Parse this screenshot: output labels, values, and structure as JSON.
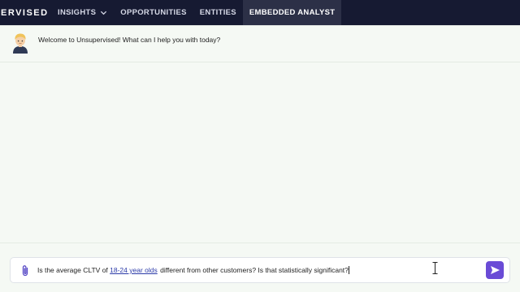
{
  "header": {
    "brand": "ERVISED",
    "nav": [
      {
        "label": "INSIGHTS",
        "has_dropdown": true
      },
      {
        "label": "OPPORTUNITIES"
      },
      {
        "label": "ENTITIES"
      },
      {
        "label": "EMBEDDED ANALYST",
        "active": true
      }
    ]
  },
  "chat": {
    "messages": [
      {
        "sender_icon": "avatar-icon",
        "text": "Welcome to Unsupervised! What can I help you with today?"
      }
    ]
  },
  "composer": {
    "query_prefix": "Is the average CLTV of ",
    "query_link": "18-24 year olds",
    "query_suffix": " different from other customers? Is that statistically significant?",
    "attach_icon": "paperclip-icon",
    "send_icon": "send-icon"
  },
  "colors": {
    "topbar": "#161a32",
    "active_tab": "#2c3047",
    "background": "#f5f9f4",
    "send_button": "#6a4bd6",
    "link": "#2b3aa8"
  }
}
